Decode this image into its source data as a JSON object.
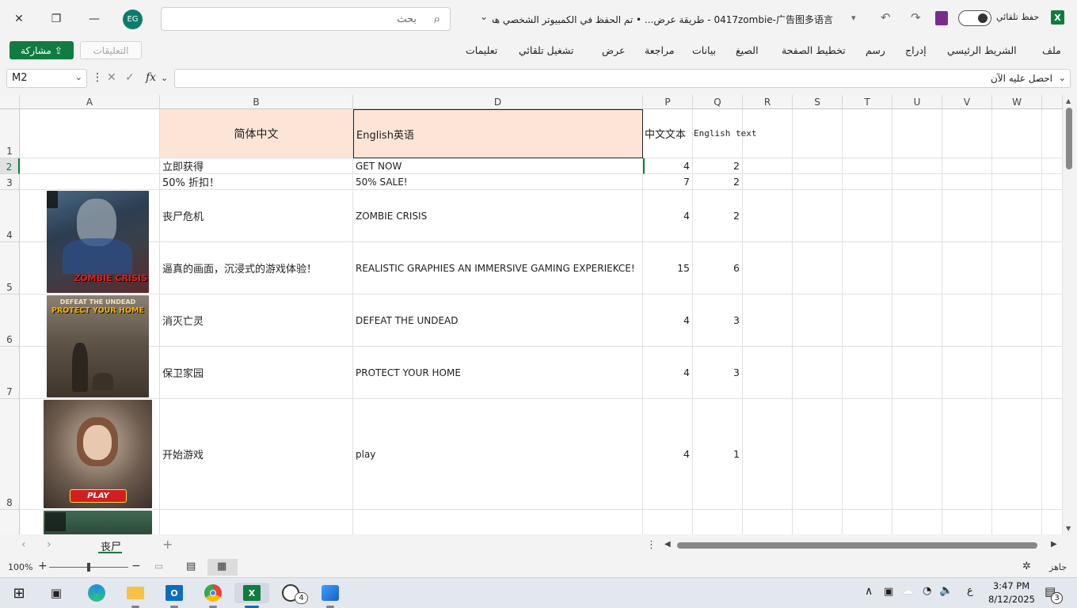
{
  "titlebar": {
    "avatar_initials": "EG",
    "search_placeholder": "بحث",
    "doc_title": "0417zombie-广告图多语言  -  طريقة عرض... • تم الحفظ في الكمبيوتر الشخصي هذا",
    "autosave_label": "حفظ تلقائي",
    "app_icon_letter": "X"
  },
  "ribbon": {
    "share_label": "مشاركة",
    "comments_label": "التعليقات",
    "menus": [
      "ملف",
      "الشريط الرئيسي",
      "إدراج",
      "رسم",
      "تخطيط الصفحة",
      "الصيغ",
      "بيانات",
      "مراجعة",
      "عرض",
      "تشغيل تلقائي",
      "تعليمات"
    ]
  },
  "formula_bar": {
    "name_box": "M2",
    "fx": "fx",
    "get_now": "احصل عليه الآن"
  },
  "columns": [
    "A",
    "B",
    "D",
    "P",
    "Q",
    "R",
    "S",
    "T",
    "U",
    "V",
    "W"
  ],
  "rows": [
    "1",
    "2",
    "3",
    "4",
    "5",
    "6",
    "7",
    "8"
  ],
  "table": {
    "header": {
      "zh": "简体中文",
      "en": "English英语",
      "zh_text": "中文文本",
      "en_text": "English text"
    },
    "r2": {
      "zh": "立即获得",
      "en": "GET NOW",
      "p": "4",
      "q": "2"
    },
    "r3": {
      "zh": "50% 折扣！",
      "en": "50% SALE!",
      "p": "7",
      "q": "2"
    },
    "r4": {
      "zh": "丧尸危机",
      "en": "ZOMBIE CRISIS",
      "p": "4",
      "q": "2"
    },
    "r5": {
      "zh": "逼真的画面，沉浸式的游戏体验！",
      "en": "REALISTIC GRAPHIES AN IMMERSIVE GAMING EXPERIEKCE!",
      "p": "15",
      "q": "6"
    },
    "r6": {
      "zh": "消灭亡灵",
      "en": "DEFEAT THE UNDEAD",
      "p": "4",
      "q": "3"
    },
    "r7": {
      "zh": "保卫家园",
      "en": "PROTECT YOUR HOME",
      "p": "4",
      "q": "3"
    },
    "r8": {
      "zh": "开始游戏",
      "en": "play",
      "p": "4",
      "q": "1"
    }
  },
  "images": {
    "img1_title": "ZOMBIE CRISIS",
    "img2_title_line1": "DEFEAT THE UNDEAD",
    "img2_title_line2": "PROTECT YOUR HOME",
    "img3_button": "PLAY"
  },
  "sheet": {
    "tab": "丧尸"
  },
  "status": {
    "zoom": "100%",
    "ready": "جاهز"
  },
  "taskbar": {
    "time": "3:47 PM",
    "date": "8/12/2025",
    "lang": "ع",
    "whatsapp_badge": "4",
    "notif_badge": "3"
  },
  "colors": {
    "accent": "#107c41",
    "header_fill": "#fce4d6"
  }
}
